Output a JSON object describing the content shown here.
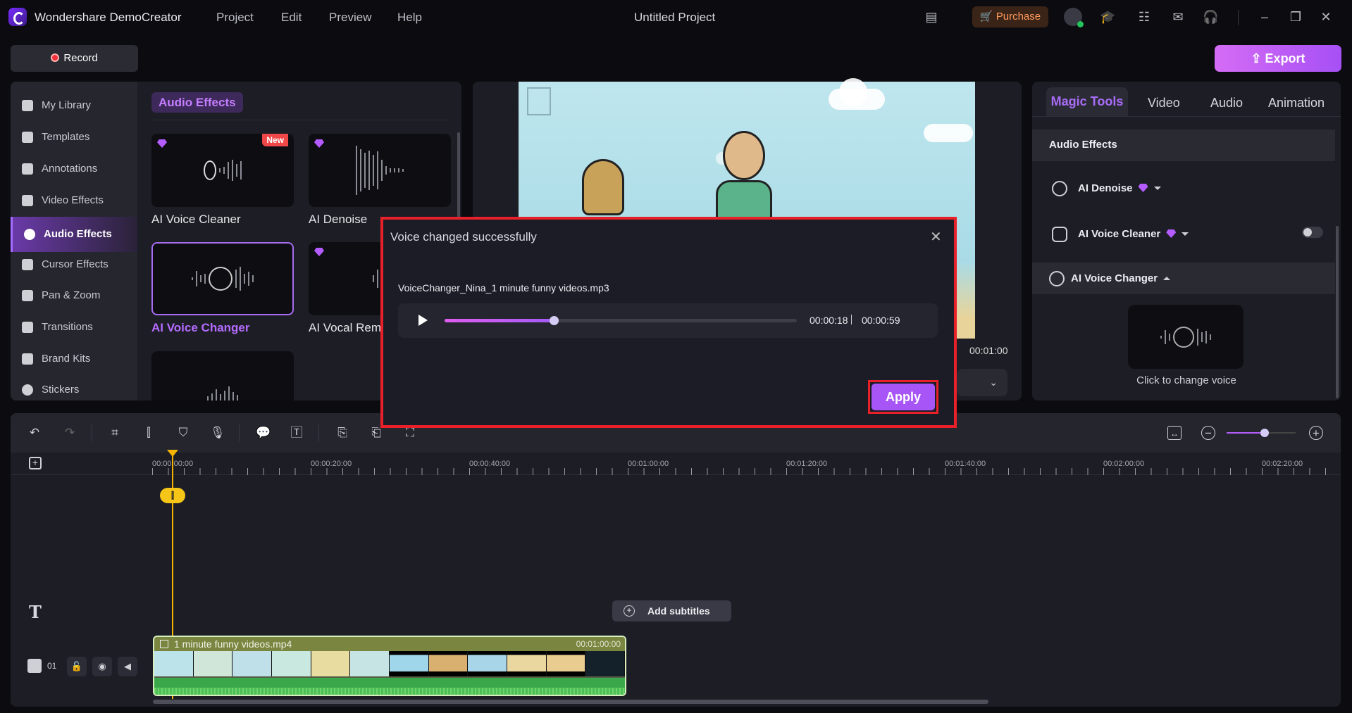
{
  "app": {
    "name": "Wondershare DemoCreator",
    "project_title": "Untitled Project",
    "menus": [
      "Project",
      "Edit",
      "Preview",
      "Help"
    ],
    "purchase_label": "Purchase"
  },
  "toolbar": {
    "record_label": "Record",
    "export_label": "Export"
  },
  "sidebar": {
    "items": [
      {
        "label": "My Library",
        "icon": "layers-icon"
      },
      {
        "label": "Templates",
        "icon": "template-icon"
      },
      {
        "label": "Annotations",
        "icon": "annotation-icon"
      },
      {
        "label": "Video Effects",
        "icon": "video-effects-icon"
      },
      {
        "label": "Audio Effects",
        "icon": "music-note-icon",
        "active": true
      },
      {
        "label": "Cursor Effects",
        "icon": "cursor-icon"
      },
      {
        "label": "Pan & Zoom",
        "icon": "pan-zoom-icon"
      },
      {
        "label": "Transitions",
        "icon": "transition-icon"
      },
      {
        "label": "Brand Kits",
        "icon": "brand-icon"
      },
      {
        "label": "Stickers",
        "icon": "sticker-icon"
      }
    ]
  },
  "library": {
    "section_title": "Audio Effects",
    "cards": [
      {
        "label": "AI Voice Cleaner",
        "premium": true,
        "badge": "New"
      },
      {
        "label": "AI Denoise",
        "premium": true
      },
      {
        "label": "AI Voice Changer",
        "selected": true
      },
      {
        "label": "AI Vocal Rem",
        "premium": true
      },
      {
        "label": ""
      }
    ]
  },
  "preview": {
    "total_time": "00:01:00"
  },
  "right_panel": {
    "tabs": [
      "Magic Tools",
      "Video",
      "Audio",
      "Animation"
    ],
    "active_tab": "Magic Tools",
    "section": "Audio Effects",
    "items": [
      {
        "label": "AI Denoise",
        "premium": true
      },
      {
        "label": "AI Voice Cleaner",
        "premium": true,
        "toggle": false
      },
      {
        "label": "AI Voice Changer",
        "expanded": true
      }
    ],
    "voice_card_label": "Click to change voice"
  },
  "dialog": {
    "title": "Voice changed successfully",
    "filename": "VoiceChanger_Nina_1 minute funny videos.mp3",
    "current_time": "00:00:18",
    "duration": "00:00:59",
    "progress": 0.31,
    "apply_label": "Apply"
  },
  "timeline": {
    "ruler_labels": [
      "00:00:00:00",
      "00:00:20:00",
      "00:00:40:00",
      "00:01:00:00",
      "00:01:20:00",
      "00:01:40:00",
      "00:02:00:00",
      "00:02:20:00"
    ],
    "add_subtitles_label": "Add subtitles",
    "track_number": "01",
    "clip": {
      "name": "1 minute funny videos.mp4",
      "duration": "00:01:00:00"
    },
    "zoom_level": 0.55
  },
  "colors": {
    "accent": "#a855f7",
    "highlight_border": "#e8202a",
    "playhead": "#f5b400"
  }
}
